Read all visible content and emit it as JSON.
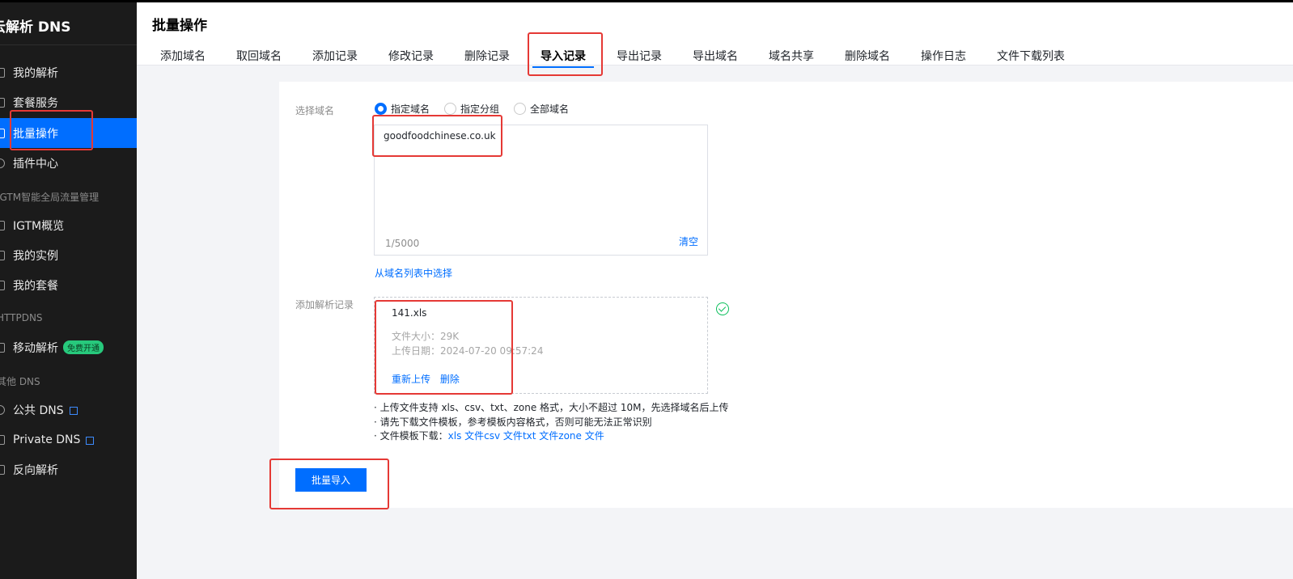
{
  "sidebar": {
    "brand": "云解析 DNS",
    "items": [
      {
        "label": "我的解析",
        "icon": "document-icon"
      },
      {
        "label": "套餐服务",
        "icon": "package-icon"
      },
      {
        "label": "批量操作",
        "icon": "batch-icon",
        "active": true
      },
      {
        "label": "插件中心",
        "icon": "plugin-icon"
      }
    ],
    "group_igtm": "IGTM智能全局流量管理",
    "igtm_items": [
      {
        "label": "IGTM概览",
        "icon": "grid-icon"
      },
      {
        "label": "我的实例",
        "icon": "instance-icon"
      },
      {
        "label": "我的套餐",
        "icon": "grid-icon"
      }
    ],
    "group_httpdns": "HTTPDNS",
    "httpdns_items": [
      {
        "label": "移动解析",
        "badge": "免费开通",
        "icon": "mobile-icon"
      }
    ],
    "group_other": "其他 DNS",
    "other_items": [
      {
        "label": "公共 DNS",
        "icon": "globe-icon"
      },
      {
        "label": "Private DNS",
        "icon": "lock-icon"
      },
      {
        "label": "反向解析",
        "icon": "reverse-icon"
      }
    ]
  },
  "header": {
    "title": "批量操作",
    "tabs": [
      "添加域名",
      "取回域名",
      "添加记录",
      "修改记录",
      "删除记录",
      "导入记录",
      "导出记录",
      "导出域名",
      "域名共享",
      "删除域名",
      "操作日志",
      "文件下载列表"
    ],
    "active_tab": "导入记录"
  },
  "form": {
    "domain_label": "选择域名",
    "radio_options": [
      "指定域名",
      "指定分组",
      "全部域名"
    ],
    "selected_radio": "指定域名",
    "domain_value": "goodfoodchinese.co.uk",
    "count": "1/5000",
    "clear_label": "清空",
    "from_list_label": "从域名列表中选择",
    "records_label": "添加解析记录",
    "file": {
      "name": "141.xls",
      "size_label": "文件大小：29K",
      "date_label": "上传日期：2024-07-20 09:57:24",
      "reupload_label": "重新上传",
      "delete_label": "删除"
    },
    "tips": {
      "line1": "· 上传文件支持 xls、csv、txt、zone 格式，大小不超过 10M，先选择域名后上传",
      "line2": "· 请先下载文件模板，参考模板内容格式，否则可能无法正常识别",
      "line3_prefix": "· 文件模板下载：",
      "templates": [
        "xls 文件",
        "csv 文件",
        "txt 文件",
        "zone 文件"
      ]
    },
    "submit_label": "批量导入"
  },
  "colors": {
    "primary": "#006eff",
    "sidebar_bg": "#1b1b1b",
    "annotation": "#e53935",
    "success": "#0abf5b"
  }
}
